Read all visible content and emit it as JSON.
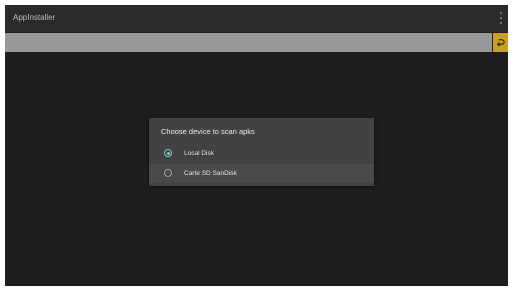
{
  "app": {
    "title": "AppInstaller"
  },
  "toolbar": {
    "path_value": "",
    "overflow_icon": "more-vert-icon",
    "back_icon": "return-arrow-icon",
    "accent_color": "#c5a227"
  },
  "dialog": {
    "title": "Choose device to scan apks",
    "options": [
      {
        "label": "Local Disk",
        "checked": true
      },
      {
        "label": "Carte SD SanDisk",
        "checked": false
      }
    ],
    "radio_color": "#80cbc4"
  }
}
